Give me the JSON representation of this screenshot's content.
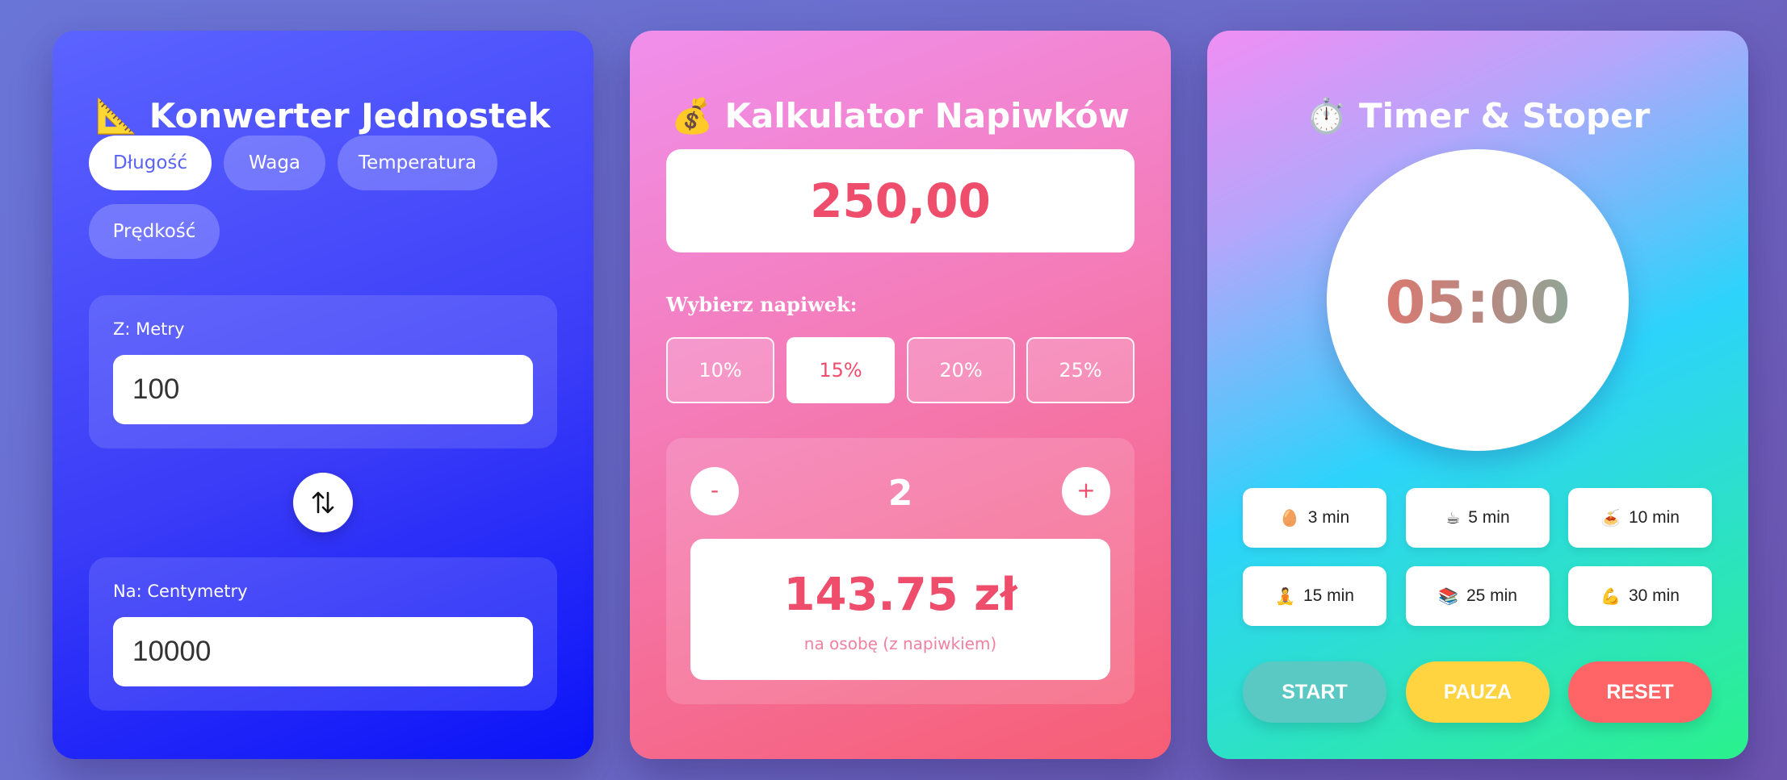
{
  "converter": {
    "emoji": "📐",
    "title": "Konwerter Jednostek",
    "tabs": [
      {
        "label": "Długość",
        "active": true
      },
      {
        "label": "Waga",
        "active": false
      },
      {
        "label": "Temperatura",
        "active": false
      },
      {
        "label": "Prędkość",
        "active": false
      }
    ],
    "from": {
      "label": "Z: Metry",
      "value": "100"
    },
    "to": {
      "label": "Na: Centymetry",
      "value": "10000"
    },
    "swap_icon": "swap-vertical-arrows-icon"
  },
  "tip_calculator": {
    "emoji": "💰",
    "title": "Kalkulator Napiwków",
    "bill_amount": "250,00",
    "tip_label": "Wybierz napiwek:",
    "tip_options": [
      {
        "label": "10%",
        "active": false
      },
      {
        "label": "15%",
        "active": true
      },
      {
        "label": "20%",
        "active": false
      },
      {
        "label": "25%",
        "active": false
      }
    ],
    "decrement_label": "-",
    "increment_label": "+",
    "people_count": "2",
    "per_person_amount": "143.75 zł",
    "per_person_caption": "na osobę (z napiwkiem)"
  },
  "timer": {
    "emoji": "⏱️",
    "title": "Timer & Stoper",
    "display": "05:00",
    "presets": [
      {
        "emoji": "🥚",
        "label": "3 min",
        "icon": "egg-icon"
      },
      {
        "emoji": "☕",
        "label": "5 min",
        "icon": "coffee-icon"
      },
      {
        "emoji": "🍝",
        "label": "10 min",
        "icon": "pasta-icon"
      },
      {
        "emoji": "🧘",
        "label": "15 min",
        "icon": "meditation-icon"
      },
      {
        "emoji": "📚",
        "label": "25 min",
        "icon": "books-icon"
      },
      {
        "emoji": "💪",
        "label": "30 min",
        "icon": "flexed-biceps-icon"
      }
    ],
    "controls": {
      "start": {
        "label": "START",
        "color": "#5bc9c3"
      },
      "pause": {
        "label": "PAUZA",
        "color": "#ffd440"
      },
      "reset": {
        "label": "RESET",
        "color": "#ff6466"
      }
    }
  },
  "colors": {
    "converter_accent": "#5b63f4",
    "tip_accent": "#ef4d6c"
  }
}
